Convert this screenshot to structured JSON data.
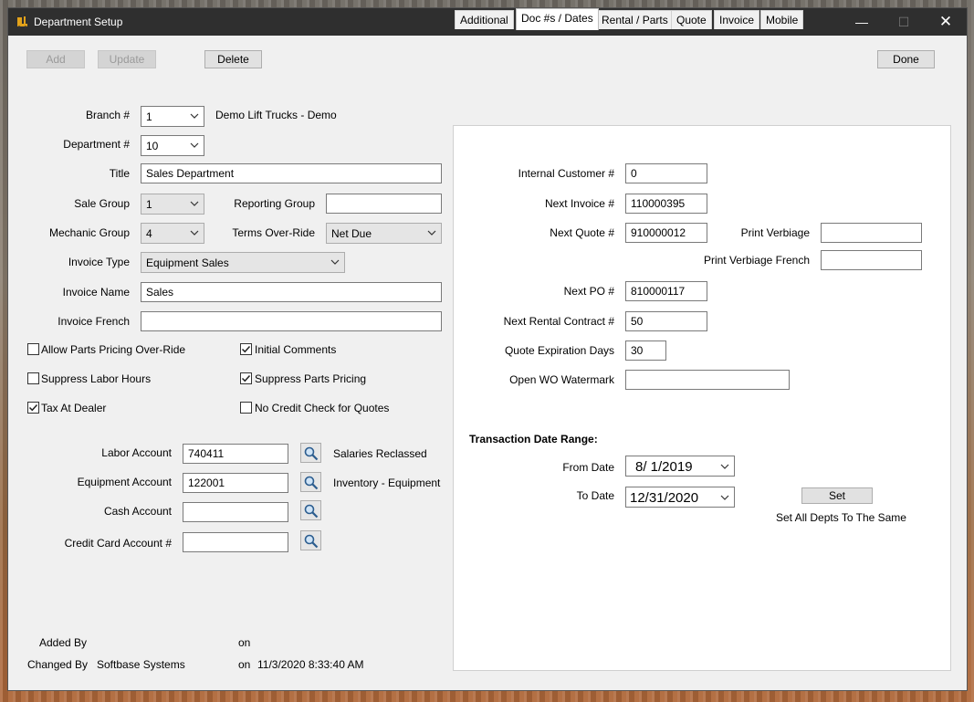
{
  "window": {
    "title": "Department Setup",
    "icons": {
      "app": "forklift-app-icon",
      "minimize": "minimize-icon",
      "maximize": "maximize-icon",
      "close": "close-icon"
    }
  },
  "toolbar": {
    "add": "Add",
    "update": "Update",
    "delete": "Delete",
    "done": "Done"
  },
  "form": {
    "branch": {
      "label": "Branch #",
      "value": "1",
      "name": "Demo Lift Trucks - Demo"
    },
    "department": {
      "label": "Department #",
      "value": "10"
    },
    "title": {
      "label": "Title",
      "value": "Sales Department"
    },
    "sale_group": {
      "label": "Sale Group",
      "value": "1"
    },
    "reporting_group": {
      "label": "Reporting Group",
      "value": ""
    },
    "mechanic_group": {
      "label": "Mechanic Group",
      "value": "4"
    },
    "terms_override": {
      "label": "Terms Over-Ride",
      "value": "Net Due"
    },
    "invoice_type": {
      "label": "Invoice Type",
      "value": "Equipment Sales"
    },
    "invoice_name": {
      "label": "Invoice Name",
      "value": "Sales"
    },
    "invoice_french": {
      "label": "Invoice French",
      "value": ""
    },
    "checkboxes": {
      "allow_parts_pricing": {
        "label": "Allow Parts Pricing Over-Ride",
        "checked": false
      },
      "initial_comments": {
        "label": "Initial Comments",
        "checked": true
      },
      "suppress_labor": {
        "label": "Suppress Labor Hours",
        "checked": false
      },
      "suppress_parts": {
        "label": "Suppress Parts Pricing",
        "checked": true
      },
      "tax_at_dealer": {
        "label": "Tax At Dealer",
        "checked": true
      },
      "no_credit_check": {
        "label": "No Credit Check for Quotes",
        "checked": false
      }
    },
    "labor_account": {
      "label": "Labor Account",
      "value": "740411",
      "desc": "Salaries Reclassed"
    },
    "equipment_account": {
      "label": "Equipment Account",
      "value": "122001",
      "desc": "Inventory - Equipment"
    },
    "cash_account": {
      "label": "Cash Account",
      "value": ""
    },
    "credit_card_account": {
      "label": "Credit Card Account #",
      "value": ""
    },
    "lookup_icon": "magnifier-icon"
  },
  "footer": {
    "added_by_label": "Added By",
    "added_by": "",
    "added_on_label": "on",
    "added_on": "",
    "changed_by_label": "Changed By",
    "changed_by": "Softbase Systems",
    "changed_on_label": "on",
    "changed_on": "11/3/2020 8:33:40 AM"
  },
  "tabs": [
    "Additional",
    "Doc #s / Dates",
    "Rental / Parts",
    "Quote",
    "Invoice",
    "Mobile"
  ],
  "active_tab": "Doc #s / Dates",
  "docs": {
    "internal_customer": {
      "label": "Internal Customer #",
      "value": "0"
    },
    "next_invoice": {
      "label": "Next Invoice #",
      "value": "110000395"
    },
    "next_quote": {
      "label": "Next Quote #",
      "value": "910000012"
    },
    "print_verbiage": {
      "label": "Print Verbiage",
      "value": ""
    },
    "print_verbiage_french": {
      "label": "Print Verbiage French",
      "value": ""
    },
    "next_po": {
      "label": "Next PO #",
      "value": "810000117"
    },
    "next_rental": {
      "label": "Next Rental Contract #",
      "value": "50"
    },
    "quote_expiration": {
      "label": "Quote Expiration Days",
      "value": "30"
    },
    "open_wo_watermark": {
      "label": "Open WO Watermark",
      "value": ""
    },
    "transaction_range": "Transaction Date Range:",
    "from_date": {
      "label": "From Date",
      "value": "8/  1/2019"
    },
    "to_date": {
      "label": "To Date",
      "value": "12/31/2020"
    },
    "set_button": "Set",
    "set_all_note": "Set All Depts To The Same"
  }
}
